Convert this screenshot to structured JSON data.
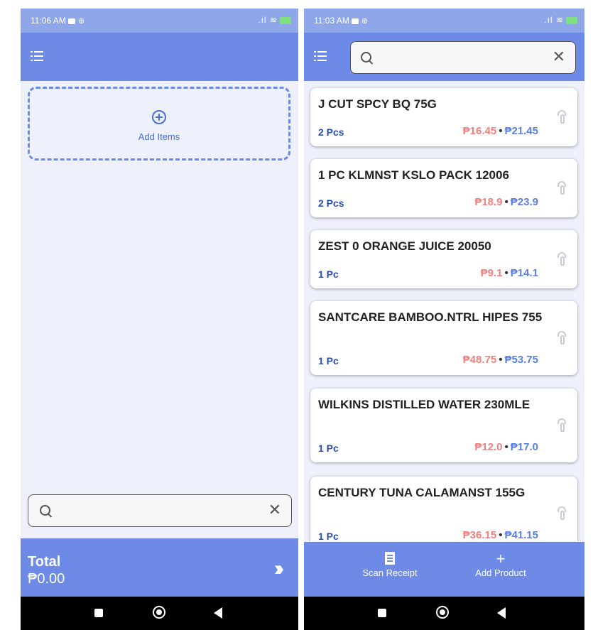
{
  "left_screen": {
    "status": {
      "time": "11:06 AM",
      "battery": "100"
    },
    "add_items_label": "Add Items",
    "search": {
      "placeholder": ""
    },
    "total": {
      "label": "Total",
      "value": "₱0.00"
    }
  },
  "right_screen": {
    "status": {
      "time": "11:03 AM",
      "battery": "100"
    },
    "search": {
      "placeholder": ""
    },
    "items": [
      {
        "name": "J CUT SPCY BQ 75G",
        "qty": "2 Pcs",
        "cost": "₱16.45",
        "price": "₱21.45"
      },
      {
        "name": "1 PC KLMNST KSLO PACK 12006",
        "qty": "2 Pcs",
        "cost": "₱18.9",
        "price": "₱23.9"
      },
      {
        "name": "ZEST 0 ORANGE JUICE 20050",
        "qty": "1 Pc",
        "cost": "₱9.1",
        "price": "₱14.1"
      },
      {
        "name": "SANTCARE BAMBOO.NTRL HIPES 755",
        "qty": "1 Pc",
        "cost": "₱48.75",
        "price": "₱53.75"
      },
      {
        "name": "WILKINS DISTILLED WATER 230MLE",
        "qty": "1 Pc",
        "cost": "₱12.0",
        "price": "₱17.0"
      },
      {
        "name": "CENTURY TUNA CALAMANST 155G",
        "qty": "1 Pc",
        "cost": "₱36.15",
        "price": "₱41.15"
      }
    ],
    "bottom_nav": {
      "scan_receipt": "Scan Receipt",
      "add_product": "Add Product"
    }
  },
  "separator": "•",
  "icons": {
    "menu": "menu-icon",
    "add": "add-circle-icon",
    "search": "search-icon",
    "clear": "close-icon",
    "proceed": "double-chevron-right-icon",
    "tap": "tap-hand-icon",
    "receipt": "receipt-icon",
    "plus": "plus-icon",
    "recents": "square-icon",
    "home": "home-circle-icon",
    "back": "back-triangle-icon"
  },
  "colors": {
    "appbar": "#6c8ae6",
    "status_bar": "#8fa7e8",
    "screen_bg": "#eef1fb",
    "cost": "#f08080",
    "price": "#5a7fe0",
    "qty": "#2a4bb8"
  }
}
